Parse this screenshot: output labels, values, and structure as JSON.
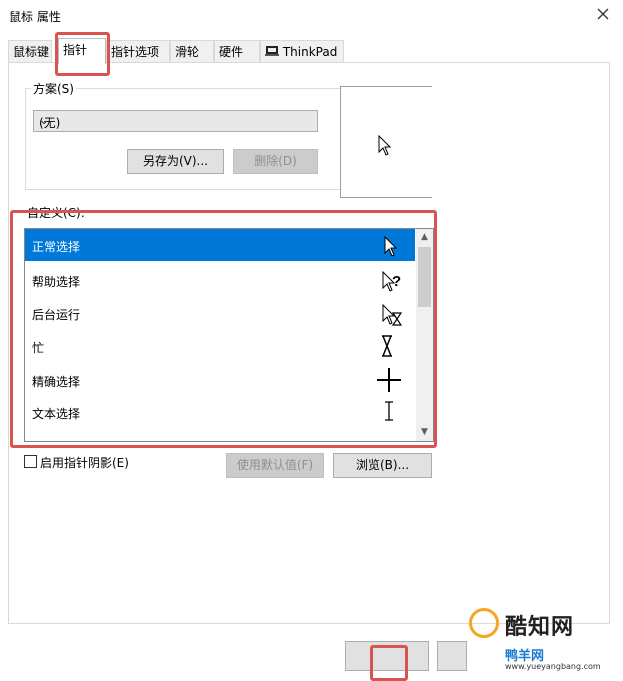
{
  "window": {
    "title": "鼠标 属性"
  },
  "tabs": [
    {
      "label": "鼠标键"
    },
    {
      "label": "指针"
    },
    {
      "label": "指针选项"
    },
    {
      "label": "滑轮"
    },
    {
      "label": "硬件"
    },
    {
      "label": "ThinkPad"
    }
  ],
  "scheme": {
    "label": "方案(S)",
    "value": "(无)",
    "save_as": "另存为(V)...",
    "delete": "删除(D)"
  },
  "customize": {
    "label": "自定义(C):",
    "items": [
      {
        "label": "正常选择",
        "icon": "arrow-cursor-icon",
        "selected": true
      },
      {
        "label": "帮助选择",
        "icon": "help-cursor-icon",
        "selected": false
      },
      {
        "label": "后台运行",
        "icon": "working-cursor-icon",
        "selected": false
      },
      {
        "label": "忙",
        "icon": "busy-hourglass-icon",
        "selected": false
      },
      {
        "label": "精确选择",
        "icon": "crosshair-cursor-icon",
        "selected": false
      },
      {
        "label": "文本选择",
        "icon": "ibeam-cursor-icon",
        "selected": false
      }
    ]
  },
  "options": {
    "shadow_label": "启用指针阴影(E)",
    "shadow_checked": false,
    "use_default": "使用默认值(F)",
    "browse": "浏览(B)..."
  },
  "watermark": {
    "brand": "酷知网",
    "site": "鸭羊网",
    "url": "www.yueyangbang.com"
  },
  "colors": {
    "selection": "#0078d7",
    "highlight_box": "#d9534f"
  }
}
